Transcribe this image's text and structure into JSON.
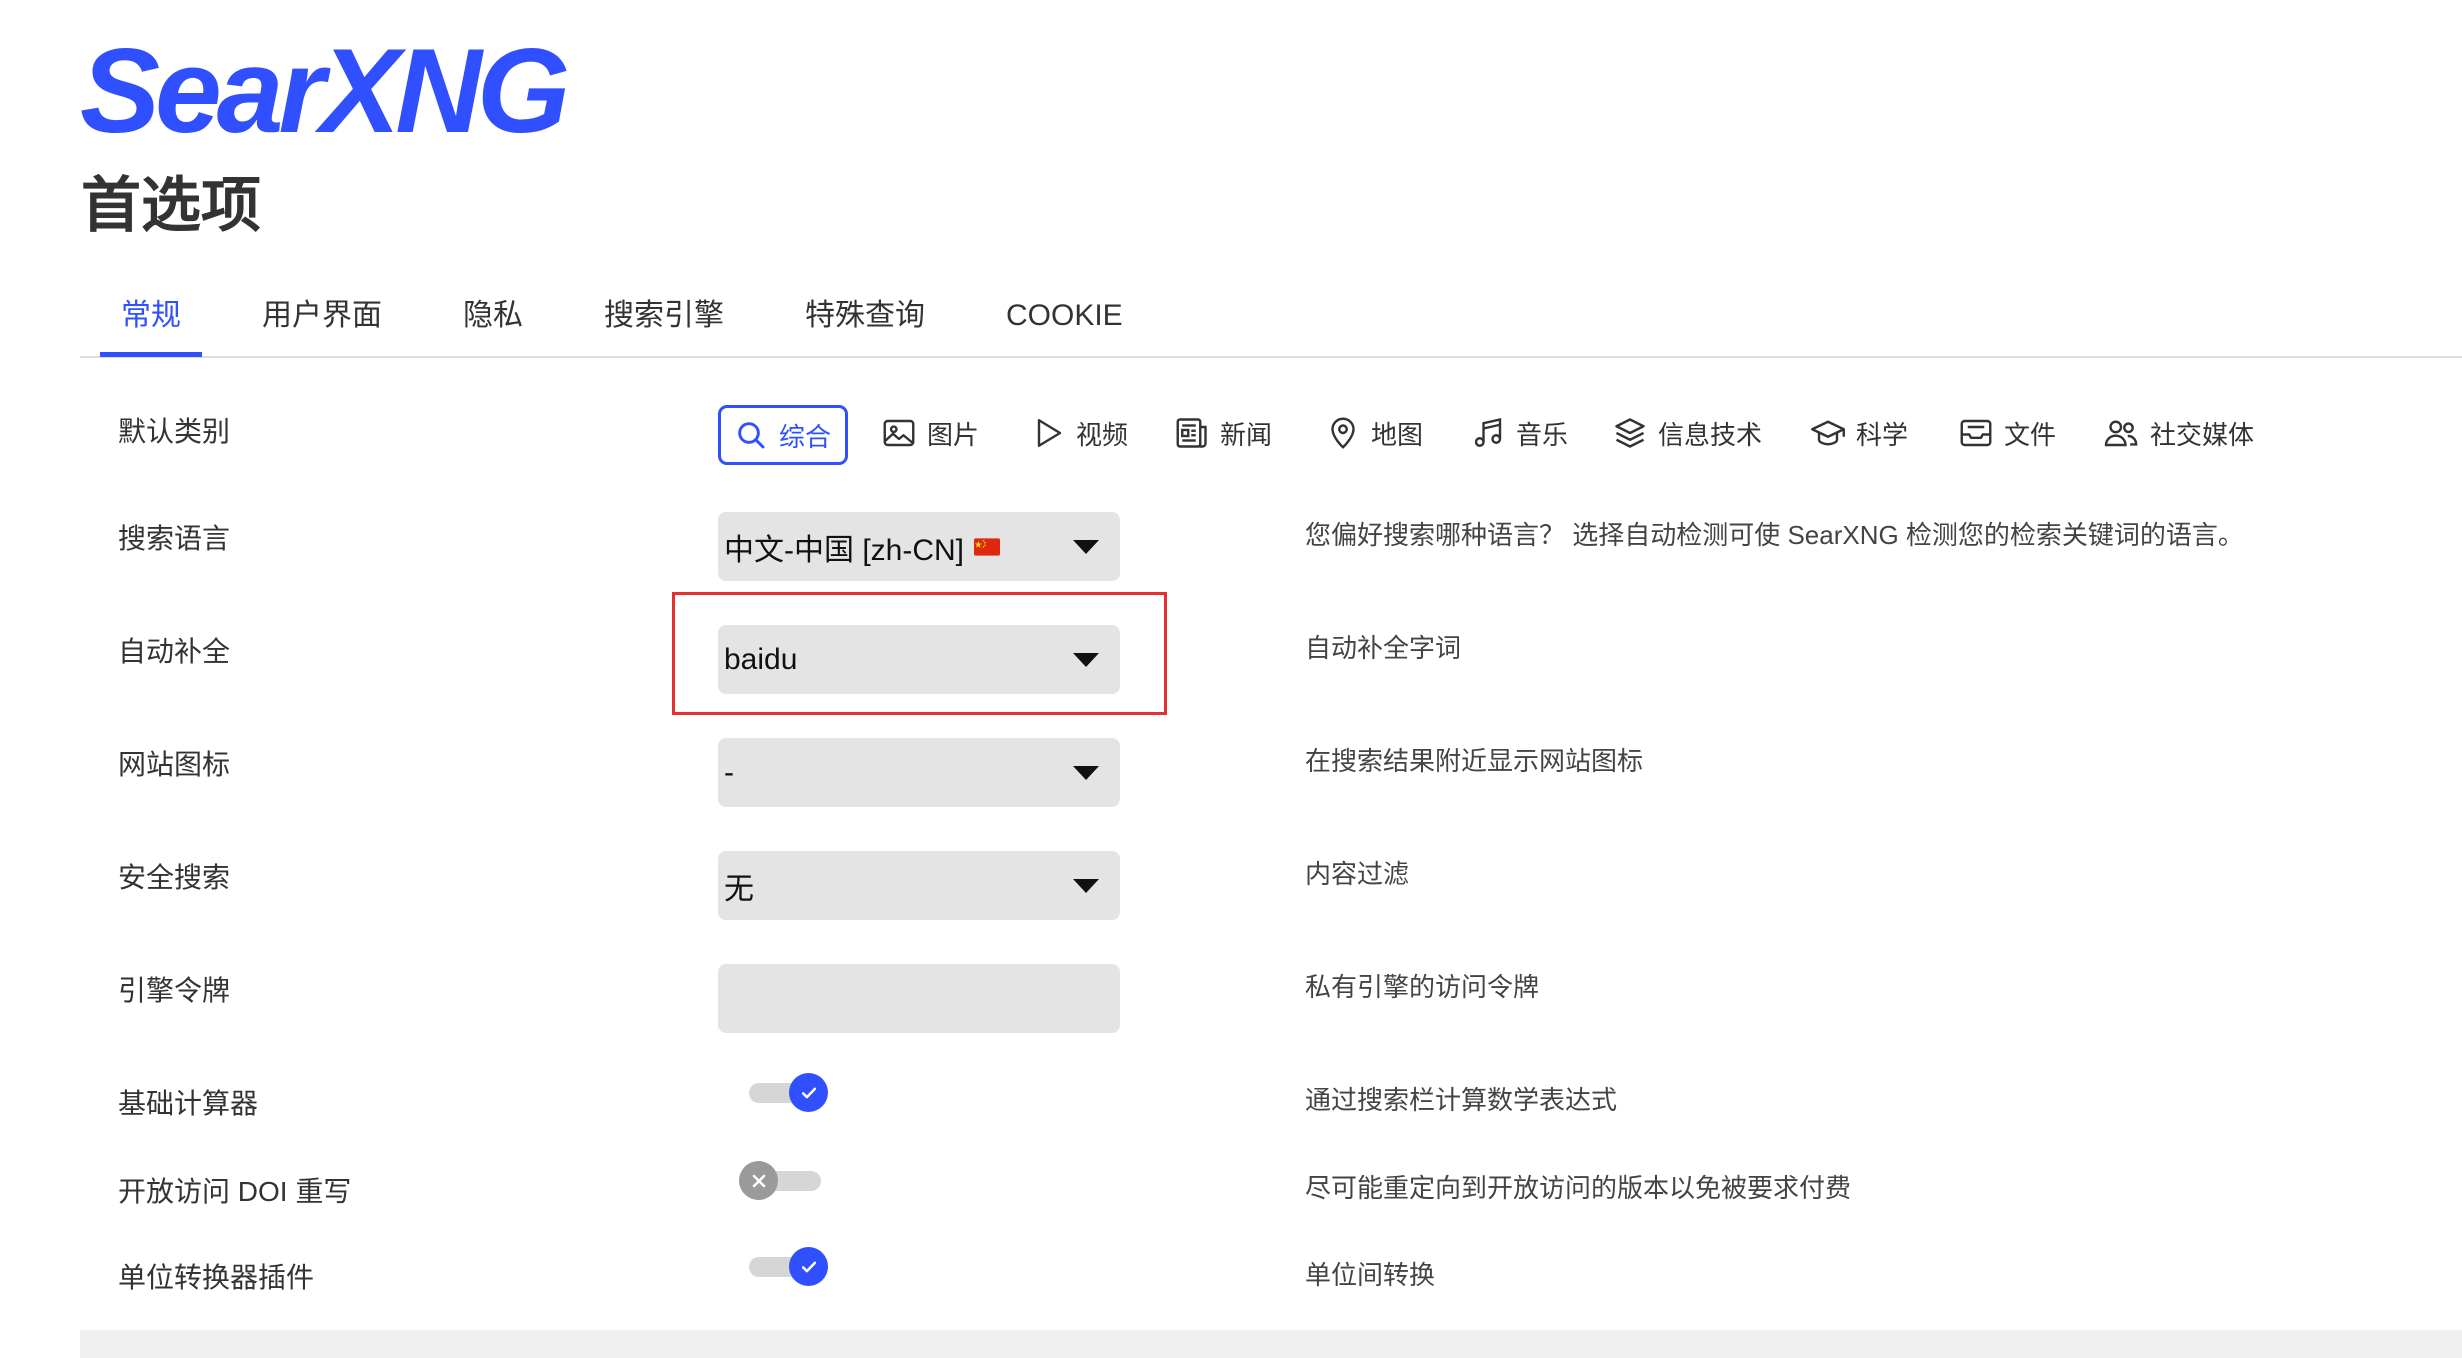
{
  "app": {
    "logo": "SearXNG"
  },
  "page": {
    "title": "首选项"
  },
  "tabs": [
    {
      "label": "常规",
      "active": true
    },
    {
      "label": "用户界面",
      "active": false
    },
    {
      "label": "隐私",
      "active": false
    },
    {
      "label": "搜索引擎",
      "active": false
    },
    {
      "label": "特殊查询",
      "active": false
    },
    {
      "label": "COOKIE",
      "active": false
    }
  ],
  "general": {
    "categories": {
      "label": "默认类别",
      "items": [
        {
          "label": "综合",
          "icon": "search-icon",
          "selected": true
        },
        {
          "label": "图片",
          "icon": "image-icon",
          "selected": false
        },
        {
          "label": "视频",
          "icon": "play-icon",
          "selected": false
        },
        {
          "label": "新闻",
          "icon": "newspaper-icon",
          "selected": false
        },
        {
          "label": "地图",
          "icon": "map-pin-icon",
          "selected": false
        },
        {
          "label": "音乐",
          "icon": "music-note-icon",
          "selected": false
        },
        {
          "label": "信息技术",
          "icon": "layers-icon",
          "selected": false
        },
        {
          "label": "科学",
          "icon": "graduation-cap-icon",
          "selected": false
        },
        {
          "label": "文件",
          "icon": "archive-tray-icon",
          "selected": false
        },
        {
          "label": "社交媒体",
          "icon": "people-icon",
          "selected": false
        }
      ]
    },
    "language": {
      "label": "搜索语言",
      "value": "中文-中国 [zh-CN]",
      "flag_icon": "cn-flag-icon",
      "description": "您偏好搜索哪种语言？ 选择自动检测可使 SearXNG 检测您的检索关键词的语言。"
    },
    "autocomplete": {
      "label": "自动补全",
      "value": "baidu",
      "description": "自动补全字词"
    },
    "favicon": {
      "label": "网站图标",
      "value": "-",
      "description": "在搜索结果附近显示网站图标"
    },
    "safesearch": {
      "label": "安全搜索",
      "value": "无",
      "description": "内容过滤"
    },
    "engine_tokens": {
      "label": "引擎令牌",
      "description": "私有引擎的访问令牌"
    },
    "plugins": [
      {
        "label": "基础计算器",
        "enabled": true,
        "description": "通过搜索栏计算数学表达式"
      },
      {
        "label": "开放访问 DOI 重写",
        "enabled": false,
        "description": "尽可能重定向到开放访问的版本以免被要求付费"
      },
      {
        "label": "单位转换器插件",
        "enabled": true,
        "description": "单位间转换"
      }
    ]
  },
  "colors": {
    "accent": "#3050ff",
    "highlight": "#e53030",
    "select_bg": "#e4e4e4",
    "toggle_off": "#9a9a9a"
  }
}
